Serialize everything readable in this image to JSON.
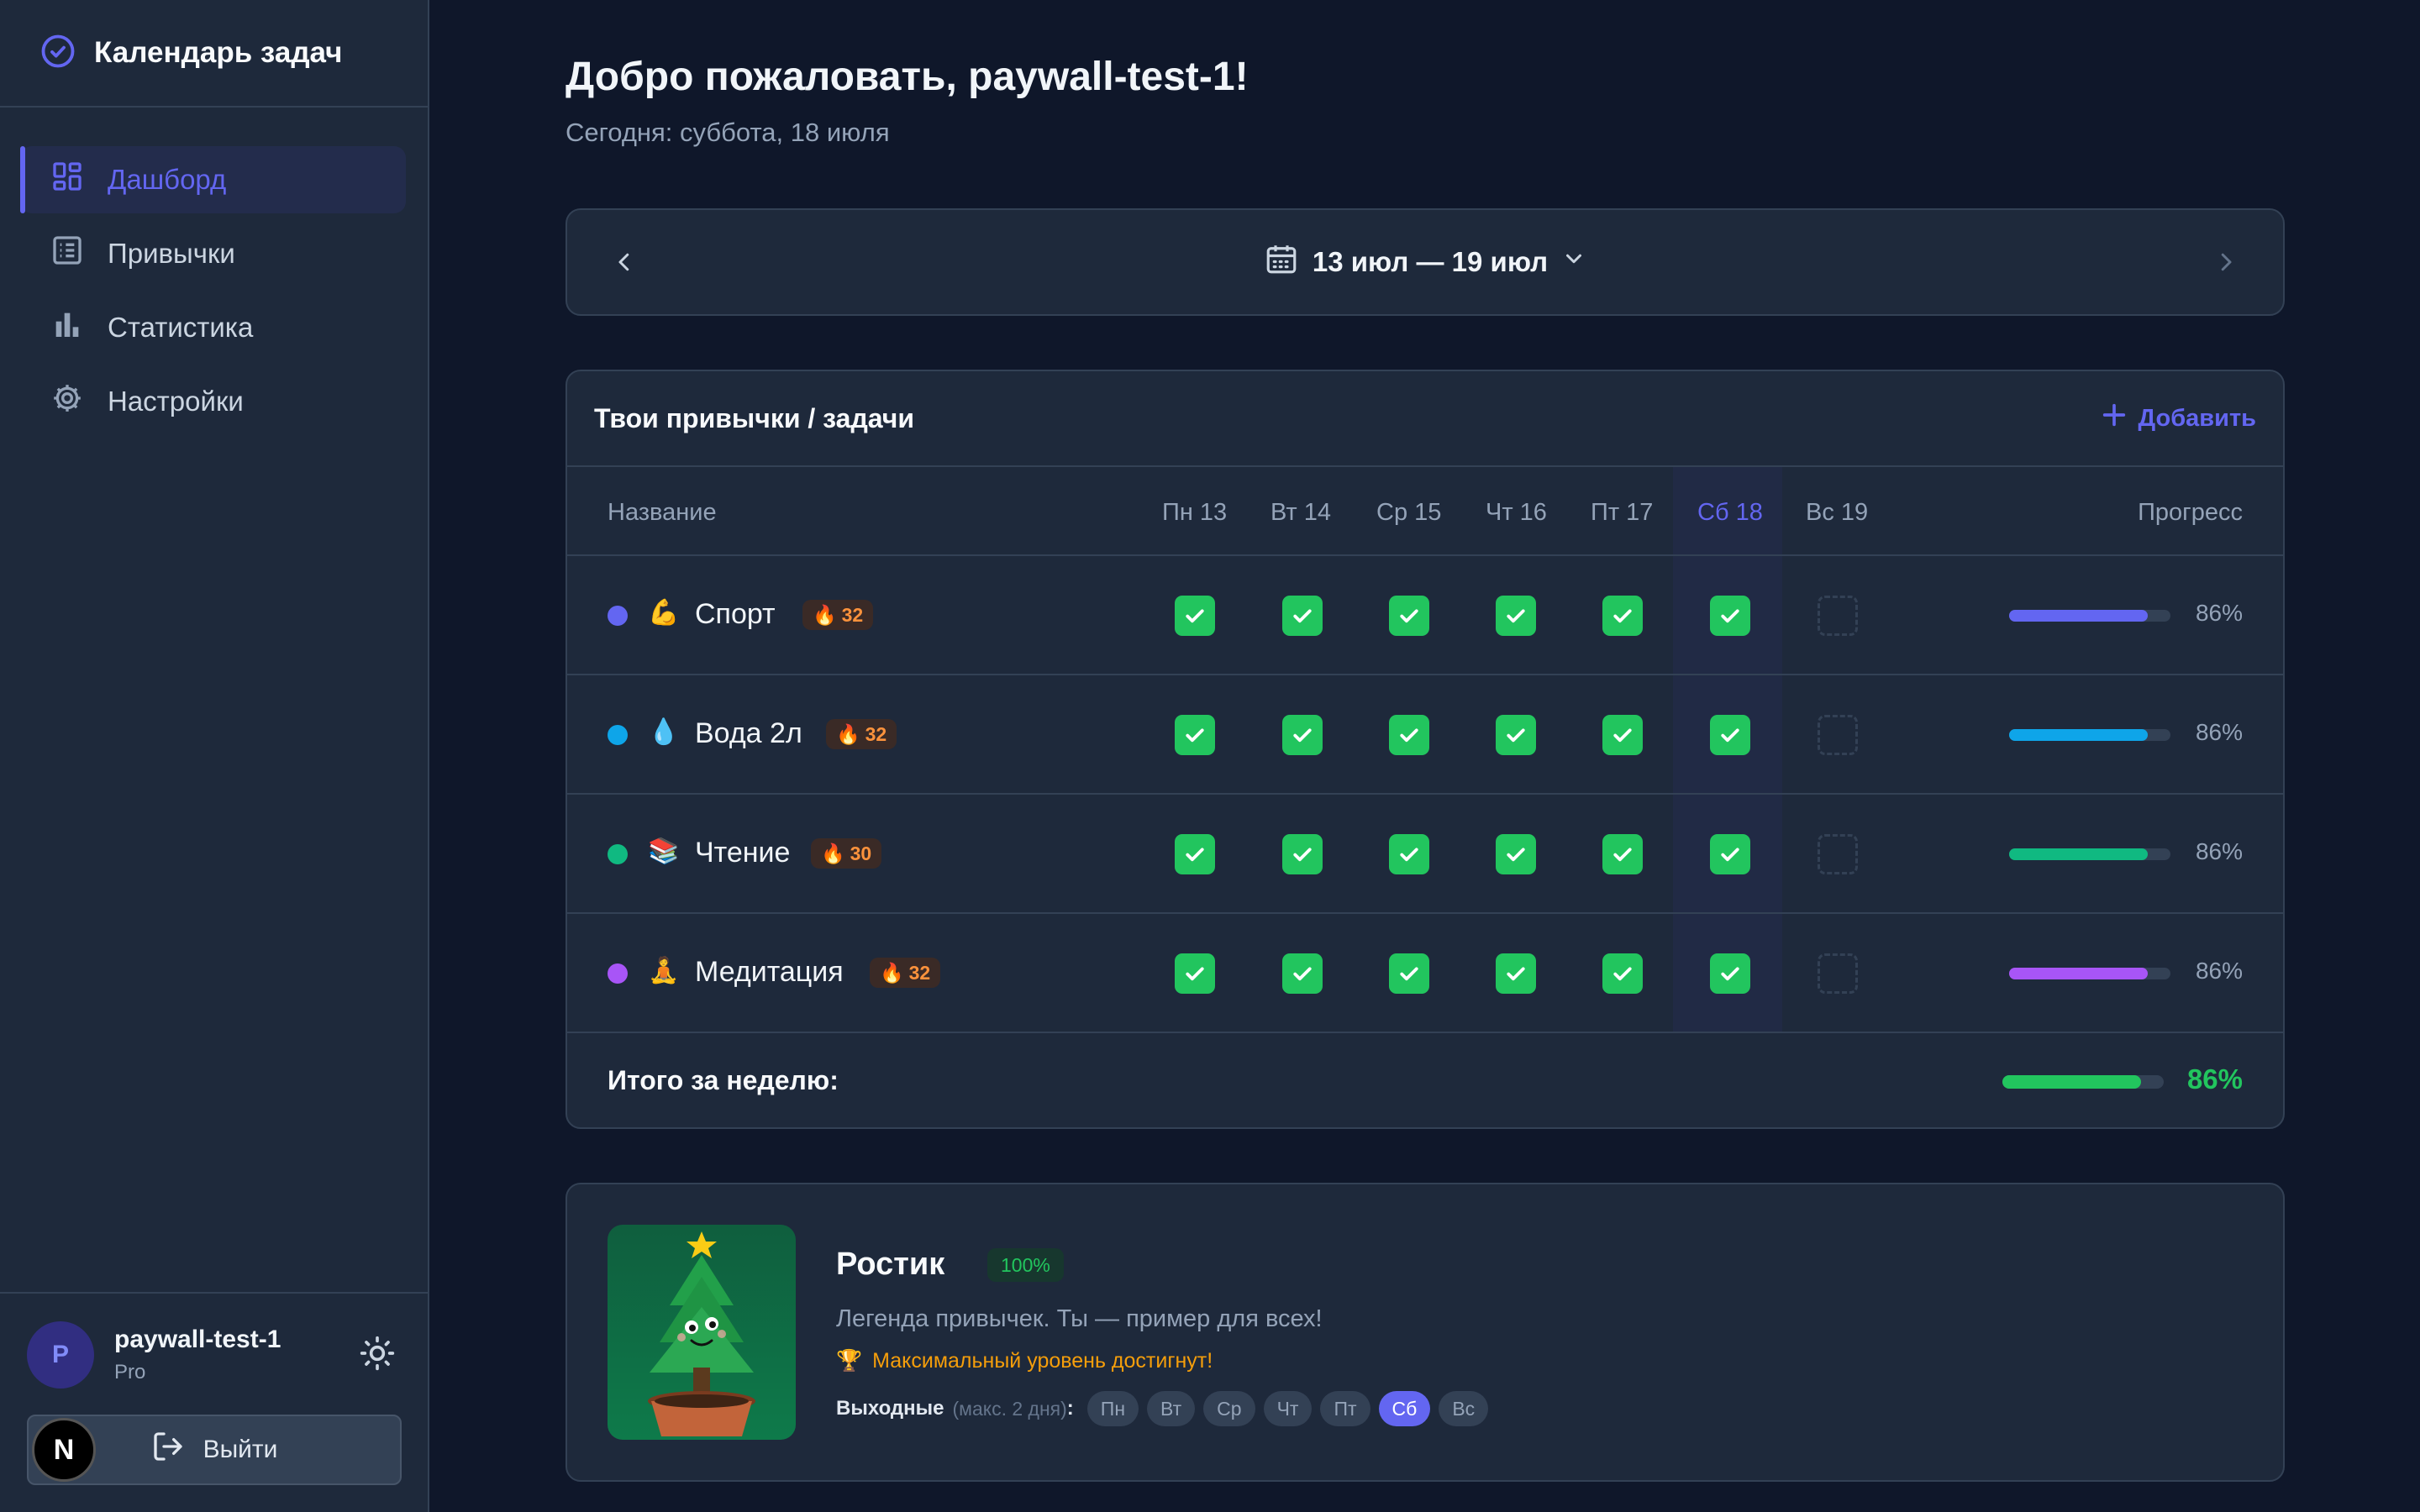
{
  "app": {
    "title": "Календарь задач"
  },
  "nav": [
    {
      "label": "Дашборд",
      "icon": "dashboard-icon",
      "active": true
    },
    {
      "label": "Привычки",
      "icon": "list-icon",
      "active": false
    },
    {
      "label": "Статистика",
      "icon": "bar-chart-icon",
      "active": false
    },
    {
      "label": "Настройки",
      "icon": "gear-icon",
      "active": false
    }
  ],
  "user": {
    "initial": "P",
    "name": "paywall-test-1",
    "plan": "Pro",
    "logout_label": "Выйти",
    "n_badge": "N"
  },
  "header": {
    "welcome": "Добро пожаловать, paywall-test-1!",
    "today": "Сегодня: суббота, 18 июля"
  },
  "week": {
    "range": "13 июл — 19 июл"
  },
  "habits": {
    "title": "Твои привычки / задачи",
    "add_label": "Добавить",
    "columns": {
      "name": "Название",
      "progress": "Прогресс"
    },
    "days": [
      "Пн 13",
      "Вт 14",
      "Ср 15",
      "Чт 16",
      "Пт 17",
      "Сб 18",
      "Вс 19"
    ],
    "rows": [
      {
        "emoji": "💪",
        "name": "Спорт",
        "streak": "32",
        "color": "#6366f1",
        "done": [
          true,
          true,
          true,
          true,
          true,
          true,
          false
        ],
        "progress": 0.86,
        "progress_label": "86%"
      },
      {
        "emoji": "💧",
        "name": "Вода 2л",
        "streak": "32",
        "color": "#0ea5e9",
        "done": [
          true,
          true,
          true,
          true,
          true,
          true,
          false
        ],
        "progress": 0.86,
        "progress_label": "86%"
      },
      {
        "emoji": "📚",
        "name": "Чтение",
        "streak": "30",
        "color": "#10b981",
        "done": [
          true,
          true,
          true,
          true,
          true,
          true,
          false
        ],
        "progress": 0.86,
        "progress_label": "86%"
      },
      {
        "emoji": "🧘",
        "name": "Медитация",
        "streak": "32",
        "color": "#a855f7",
        "done": [
          true,
          true,
          true,
          true,
          true,
          true,
          false
        ],
        "progress": 0.86,
        "progress_label": "86%"
      }
    ],
    "total_label": "Итого за неделю:",
    "total_progress": 0.86,
    "total_progress_label": "86%"
  },
  "pet": {
    "name": "Ростик",
    "level": "100%",
    "quote": "Легенда привычек. Ты — пример для всех!",
    "max_emoji": "🏆",
    "max_text": "Максимальный уровень достигнут!",
    "weekends_label": "Выходные",
    "weekends_hint": "(макс. 2 дня)",
    "weekends_colon": ":",
    "days": [
      {
        "label": "Пн",
        "on": false
      },
      {
        "label": "Вт",
        "on": false
      },
      {
        "label": "Ср",
        "on": false
      },
      {
        "label": "Чт",
        "on": false
      },
      {
        "label": "Пт",
        "on": false
      },
      {
        "label": "Сб",
        "on": true
      },
      {
        "label": "Вс",
        "on": false
      }
    ]
  },
  "colors": {
    "accent": "#6366f1",
    "success": "#22c55e",
    "streak": "#fb923c",
    "warning": "#f59e0b"
  }
}
